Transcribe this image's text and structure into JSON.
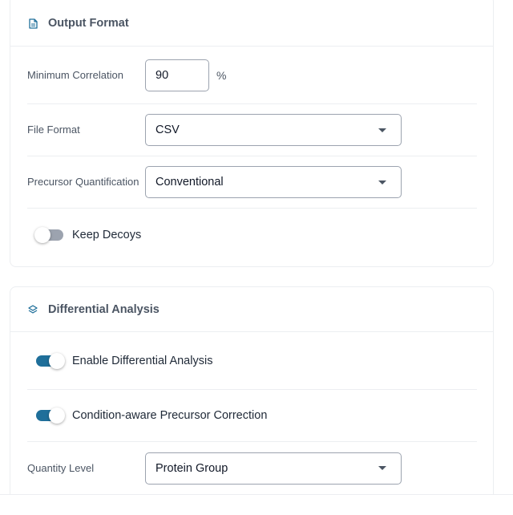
{
  "output_format": {
    "title": "Output Format",
    "icon": "document-icon",
    "min_correlation": {
      "label": "Minimum Correlation",
      "value": "90",
      "unit": "%"
    },
    "file_format": {
      "label": "File Format",
      "value": "CSV"
    },
    "precursor_quant": {
      "label": "Precursor Quantification",
      "value": "Conventional"
    },
    "keep_decoys": {
      "label": "Keep Decoys",
      "enabled": false
    }
  },
  "differential_analysis": {
    "title": "Differential Analysis",
    "icon": "layers-icon",
    "enable": {
      "label": "Enable Differential Analysis",
      "enabled": true
    },
    "condition_aware": {
      "label": "Condition-aware Precursor Correction",
      "enabled": true
    },
    "quantity_level": {
      "label": "Quantity Level",
      "value": "Protein Group"
    }
  },
  "colors": {
    "accent": "#1f6f9a",
    "toggle_off": "#9ca3af",
    "border": "#eceef1"
  }
}
